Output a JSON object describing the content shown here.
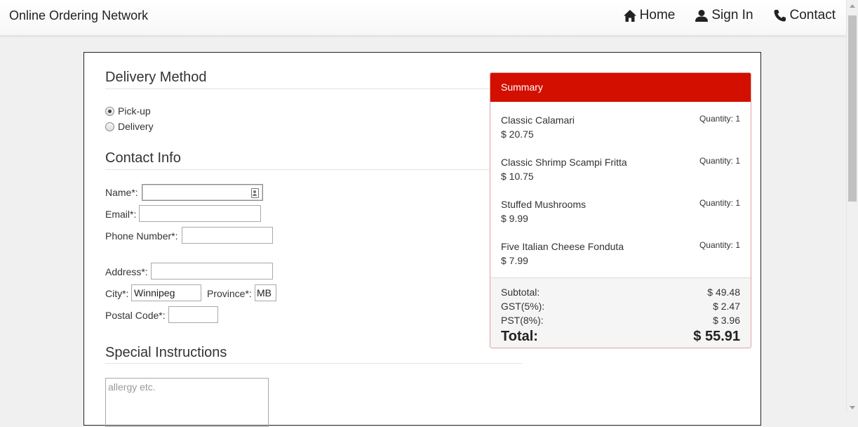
{
  "navbar": {
    "brand": "Online Ordering Network",
    "items": [
      {
        "label": "Home",
        "icon": "home-icon"
      },
      {
        "label": "Sign In",
        "icon": "user-icon"
      },
      {
        "label": "Contact",
        "icon": "phone-icon"
      }
    ]
  },
  "delivery": {
    "title": "Delivery Method",
    "options": [
      {
        "label": "Pick-up",
        "checked": true
      },
      {
        "label": "Delivery",
        "checked": false
      }
    ]
  },
  "contact": {
    "title": "Contact Info",
    "name_label": "Name*:",
    "email_label": "Email*:",
    "phone_label": "Phone Number*:",
    "address_label": "Address*:",
    "city_label": "City*:",
    "city_value": "Winnipeg",
    "province_label": "Province*:",
    "province_value": "MB",
    "postal_label": "Postal Code*:"
  },
  "special": {
    "title": "Special Instructions",
    "placeholder": "allergy etc."
  },
  "summary": {
    "title": "Summary",
    "items": [
      {
        "name": "Classic Calamari",
        "price": "$ 20.75",
        "qty": "Quantity: 1"
      },
      {
        "name": "Classic Shrimp Scampi Fritta",
        "price": "$ 10.75",
        "qty": "Quantity: 1"
      },
      {
        "name": "Stuffed Mushrooms",
        "price": "$ 9.99",
        "qty": "Quantity: 1"
      },
      {
        "name": "Five Italian Cheese Fonduta",
        "price": "$ 7.99",
        "qty": "Quantity: 1"
      }
    ],
    "subtotal_label": "Subtotal:",
    "subtotal": "$ 49.48",
    "gst_label": "GST(5%):",
    "gst": "$ 2.47",
    "pst_label": "PST(8%):",
    "pst": "$ 3.96",
    "total_label": "Total:",
    "total": "$ 55.91"
  },
  "colors": {
    "summary_header": "#d30f00"
  }
}
